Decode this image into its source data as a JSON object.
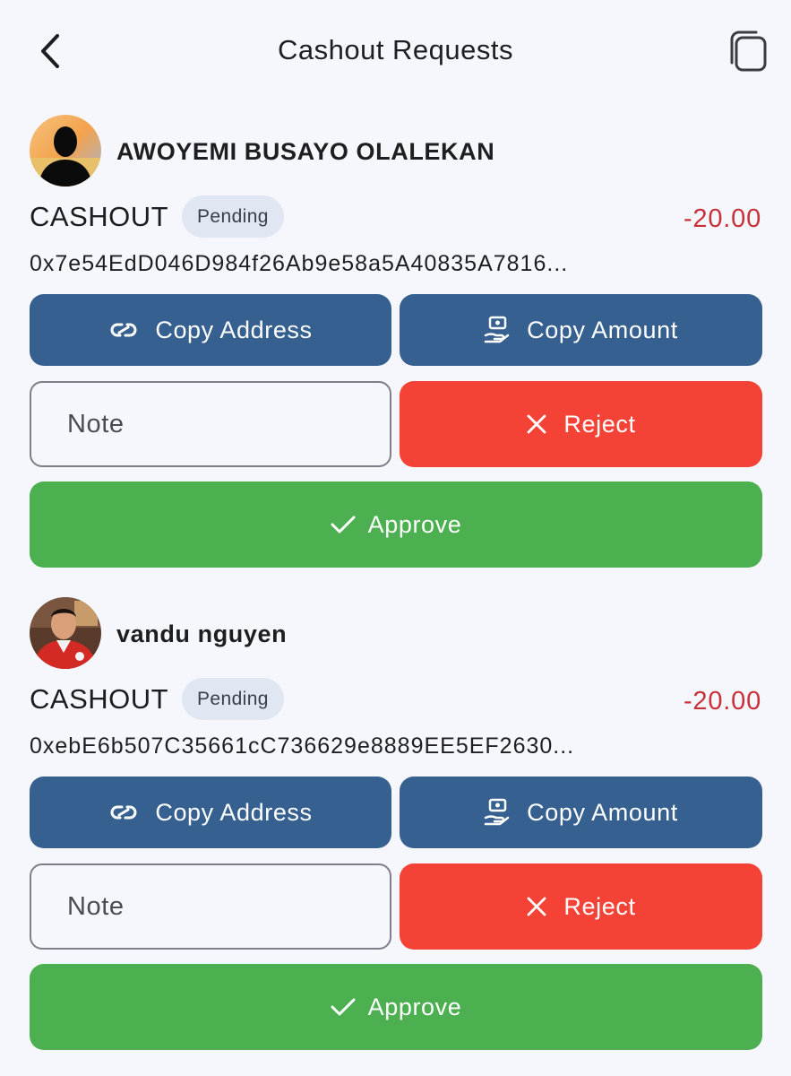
{
  "header": {
    "title": "Cashout Requests"
  },
  "requests": [
    {
      "user_name": "AWOYEMI BUSAYO OLALEKAN",
      "type": "CASHOUT",
      "status": "Pending",
      "amount": "-20.00",
      "address": "0x7e54EdD046D984f26Ab9e58a5A40835A7816...",
      "copy_address_label": "Copy Address",
      "copy_amount_label": "Copy Amount",
      "note_placeholder": "Note",
      "reject_label": "Reject",
      "approve_label": "Approve"
    },
    {
      "user_name": "vandu nguyen",
      "type": "CASHOUT",
      "status": "Pending",
      "amount": "-20.00",
      "address": "0xebE6b507C35661cC736629e8889EE5EF2630...",
      "copy_address_label": "Copy Address",
      "copy_amount_label": "Copy Amount",
      "note_placeholder": "Note",
      "reject_label": "Reject",
      "approve_label": "Approve"
    }
  ],
  "icons": {
    "back": "chevron-left-icon",
    "copy_all": "copy-icon",
    "copy_address": "link-icon",
    "copy_amount": "hand-money-icon",
    "reject": "close-icon",
    "approve": "check-icon"
  },
  "colors": {
    "background": "#f6f7fc",
    "primary_button": "#35608f",
    "reject_button": "#f44336",
    "approve_button": "#4caf50",
    "amount_negative": "#c8313a",
    "badge_background": "#e1e7f2"
  }
}
